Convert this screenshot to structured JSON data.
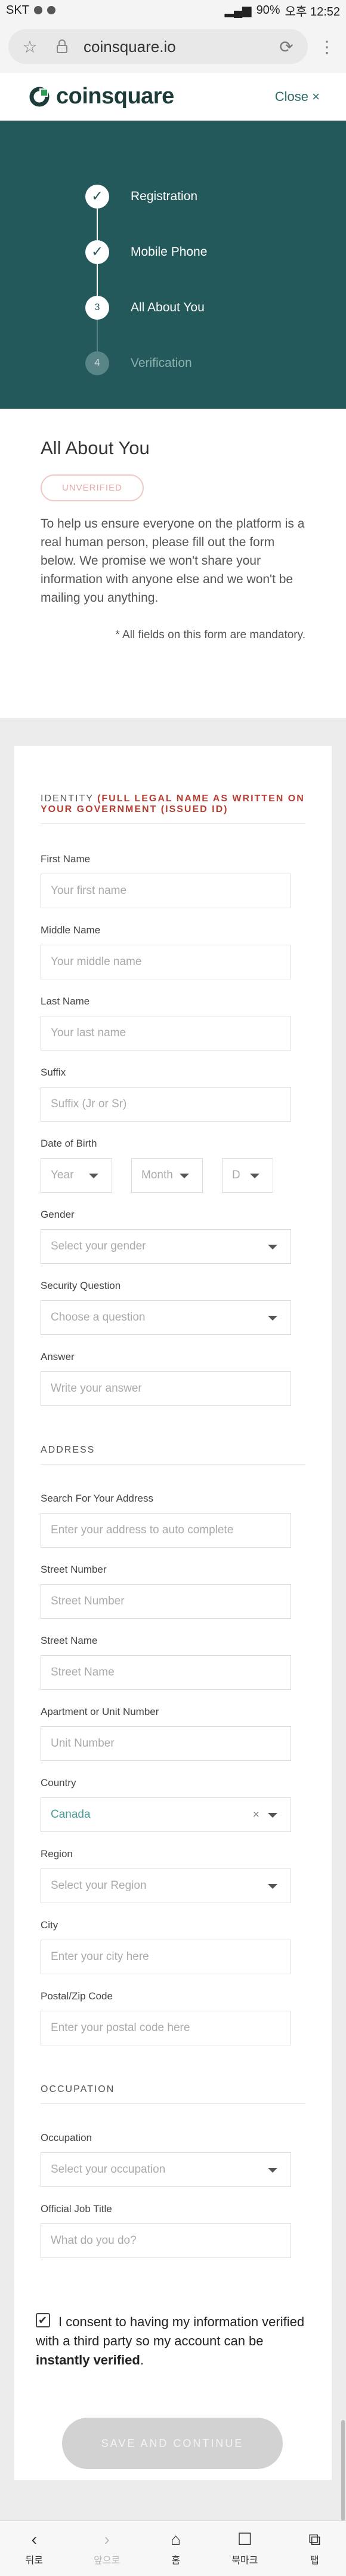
{
  "status_bar": {
    "carrier": "SKT",
    "battery": "90%",
    "time_label": "오후 12:52"
  },
  "browser": {
    "url": "coinsquare.io"
  },
  "site": {
    "brand": "coinsquare",
    "close_label": "Close ×"
  },
  "stepper": {
    "steps": [
      {
        "label": "Registration",
        "state": "done",
        "marker": "✓"
      },
      {
        "label": "Mobile Phone",
        "state": "done",
        "marker": "✓"
      },
      {
        "label": "All About You",
        "state": "current",
        "marker": "3"
      },
      {
        "label": "Verification",
        "state": "todo",
        "marker": "4"
      }
    ]
  },
  "about": {
    "title": "All About You",
    "badge": "UNVERIFIED",
    "intro": "To help us ensure everyone on the platform is a real human person, please fill out the form below. We promise we won't share your information with anyone else and we won't be mailing you anything.",
    "mandatory_note": "* All fields on this form are mandatory."
  },
  "identity": {
    "title": "IDENTITY",
    "subtitle": "(FULL LEGAL NAME AS WRITTEN ON YOUR GOVERNMENT (ISSUED ID)",
    "first_name": {
      "label": "First Name",
      "placeholder": "Your first name"
    },
    "middle_name": {
      "label": "Middle Name",
      "placeholder": "Your middle name"
    },
    "last_name": {
      "label": "Last Name",
      "placeholder": "Your last name"
    },
    "suffix": {
      "label": "Suffix",
      "placeholder": "Suffix (Jr or Sr)"
    },
    "dob": {
      "label": "Date of Birth",
      "year": "Year",
      "month": "Month",
      "day": "D"
    },
    "gender": {
      "label": "Gender",
      "placeholder": "Select your gender"
    },
    "security_question": {
      "label": "Security Question",
      "placeholder": "Choose a question"
    },
    "answer": {
      "label": "Answer",
      "placeholder": "Write your answer"
    }
  },
  "address": {
    "title": "ADDRESS",
    "search": {
      "label": "Search For Your Address",
      "placeholder": "Enter your address to auto complete"
    },
    "street_number": {
      "label": "Street Number",
      "placeholder": "Street Number"
    },
    "street_name": {
      "label": "Street Name",
      "placeholder": "Street Name"
    },
    "unit": {
      "label": "Apartment or Unit Number",
      "placeholder": "Unit Number"
    },
    "country": {
      "label": "Country",
      "value": "Canada",
      "clear": "×"
    },
    "region": {
      "label": "Region",
      "placeholder": "Select your Region"
    },
    "city": {
      "label": "City",
      "placeholder": "Enter your city here"
    },
    "postal": {
      "label": "Postal/Zip Code",
      "placeholder": "Enter your postal code here"
    }
  },
  "occupation": {
    "title": "OCCUPATION",
    "occupation": {
      "label": "Occupation",
      "placeholder": "Select your occupation"
    },
    "job_title": {
      "label": "Official Job Title",
      "placeholder": "What do you do?"
    }
  },
  "consent": {
    "checked": true,
    "text": "I consent to having my information verified with a third party so my account can be",
    "emphasis": "instantly verified",
    "end": "."
  },
  "submit_label": "SAVE AND CONTINUE",
  "bottom_nav": [
    {
      "label": "뒤로",
      "icon": "‹",
      "enabled": true
    },
    {
      "label": "앞으로",
      "icon": "›",
      "enabled": false
    },
    {
      "label": "홈",
      "icon": "⌂",
      "enabled": true
    },
    {
      "label": "북마크",
      "icon": "☐",
      "enabled": true
    },
    {
      "label": "탭",
      "icon": "⧉",
      "enabled": true
    }
  ]
}
